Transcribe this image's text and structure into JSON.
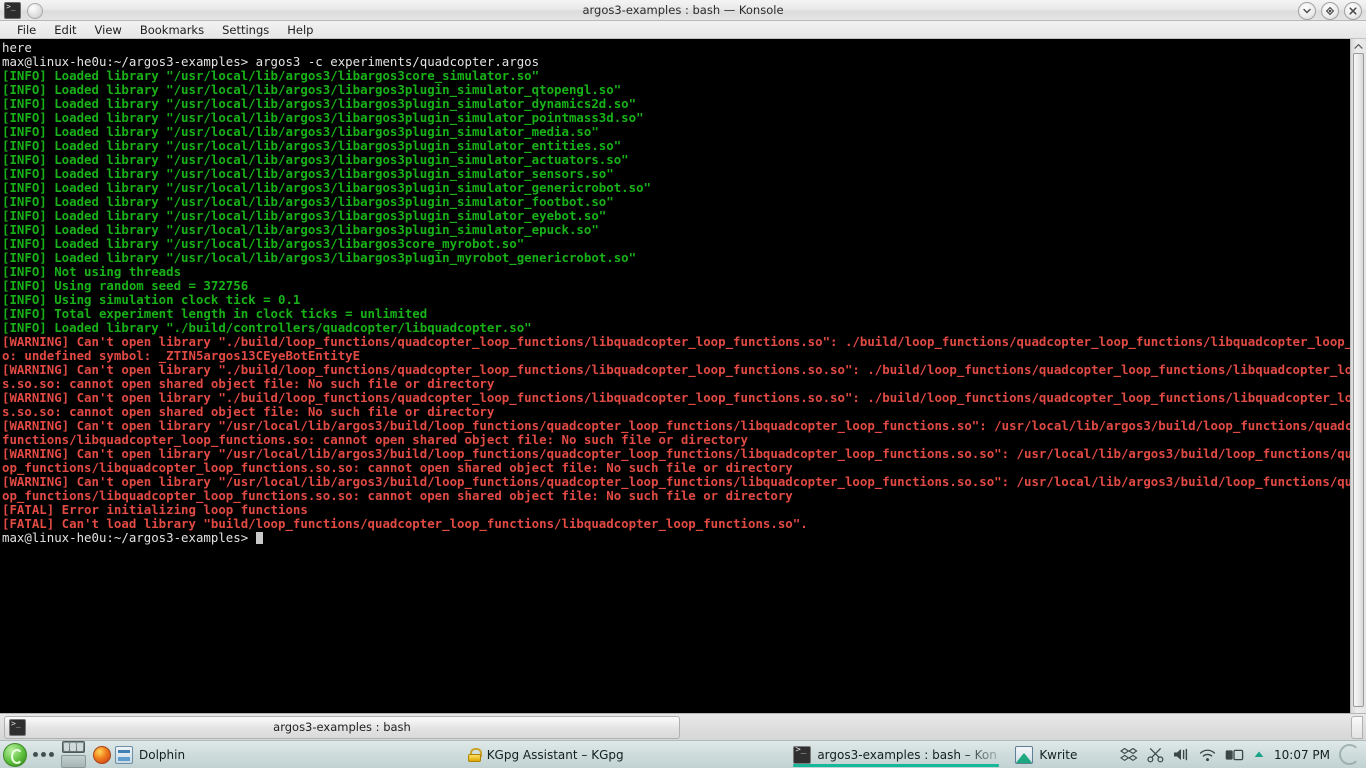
{
  "window": {
    "title": "argos3-examples : bash — Konsole",
    "app_icon": "konsole-icon",
    "controls": [
      {
        "name": "shade-button",
        "icon": "chevron-down-icon"
      },
      {
        "name": "maximize-button",
        "icon": "diamond-icon"
      },
      {
        "name": "close-button",
        "icon": "close-icon"
      }
    ]
  },
  "menubar": {
    "items": [
      {
        "label": "File"
      },
      {
        "label": "Edit"
      },
      {
        "label": "View"
      },
      {
        "label": "Bookmarks"
      },
      {
        "label": "Settings"
      },
      {
        "label": "Help"
      }
    ]
  },
  "colors": {
    "terminal_bg": "#000000",
    "text_white": "#e3e3e3",
    "text_green": "#18b218",
    "text_red": "#e24a44",
    "taskbar_accent": "#17b79a"
  },
  "terminal": {
    "prompt": "max@linux-he0u:~/argos3-examples>",
    "command": "argos3 -c experiments/quadcopter.argos",
    "lines": [
      {
        "color": "white",
        "text": "here"
      },
      {
        "color": "white",
        "text": "max@linux-he0u:~/argos3-examples> argos3 -c experiments/quadcopter.argos"
      },
      {
        "color": "green",
        "text": "[INFO] Loaded library \"/usr/local/lib/argos3/libargos3core_simulator.so\""
      },
      {
        "color": "green",
        "text": "[INFO] Loaded library \"/usr/local/lib/argos3/libargos3plugin_simulator_qtopengl.so\""
      },
      {
        "color": "green",
        "text": "[INFO] Loaded library \"/usr/local/lib/argos3/libargos3plugin_simulator_dynamics2d.so\""
      },
      {
        "color": "green",
        "text": "[INFO] Loaded library \"/usr/local/lib/argos3/libargos3plugin_simulator_pointmass3d.so\""
      },
      {
        "color": "green",
        "text": "[INFO] Loaded library \"/usr/local/lib/argos3/libargos3plugin_simulator_media.so\""
      },
      {
        "color": "green",
        "text": "[INFO] Loaded library \"/usr/local/lib/argos3/libargos3plugin_simulator_entities.so\""
      },
      {
        "color": "green",
        "text": "[INFO] Loaded library \"/usr/local/lib/argos3/libargos3plugin_simulator_actuators.so\""
      },
      {
        "color": "green",
        "text": "[INFO] Loaded library \"/usr/local/lib/argos3/libargos3plugin_simulator_sensors.so\""
      },
      {
        "color": "green",
        "text": "[INFO] Loaded library \"/usr/local/lib/argos3/libargos3plugin_simulator_genericrobot.so\""
      },
      {
        "color": "green",
        "text": "[INFO] Loaded library \"/usr/local/lib/argos3/libargos3plugin_simulator_footbot.so\""
      },
      {
        "color": "green",
        "text": "[INFO] Loaded library \"/usr/local/lib/argos3/libargos3plugin_simulator_eyebot.so\""
      },
      {
        "color": "green",
        "text": "[INFO] Loaded library \"/usr/local/lib/argos3/libargos3plugin_simulator_epuck.so\""
      },
      {
        "color": "green",
        "text": "[INFO] Loaded library \"/usr/local/lib/argos3/libargos3core_myrobot.so\""
      },
      {
        "color": "green",
        "text": "[INFO] Loaded library \"/usr/local/lib/argos3/libargos3plugin_myrobot_genericrobot.so\""
      },
      {
        "color": "green",
        "text": "[INFO] Not using threads"
      },
      {
        "color": "green",
        "text": "[INFO] Using random seed = 372756"
      },
      {
        "color": "green",
        "text": "[INFO] Using simulation clock tick = 0.1"
      },
      {
        "color": "green",
        "text": "[INFO] Total experiment length in clock ticks = unlimited"
      },
      {
        "color": "green",
        "text": "[INFO] Loaded library \"./build/controllers/quadcopter/libquadcopter.so\""
      },
      {
        "color": "red",
        "text": "[WARNING] Can't open library \"./build/loop_functions/quadcopter_loop_functions/libquadcopter_loop_functions.so\": ./build/loop_functions/quadcopter_loop_functions/libquadcopter_loop_functions.s"
      },
      {
        "color": "red",
        "text": "o: undefined symbol: _ZTIN5argos13CEyeBotEntityE"
      },
      {
        "color": "red",
        "text": "[WARNING] Can't open library \"./build/loop_functions/quadcopter_loop_functions/libquadcopter_loop_functions.so.so\": ./build/loop_functions/quadcopter_loop_functions/libquadcopter_loop_function"
      },
      {
        "color": "red",
        "text": "s.so.so: cannot open shared object file: No such file or directory"
      },
      {
        "color": "red",
        "text": "[WARNING] Can't open library \"./build/loop_functions/quadcopter_loop_functions/libquadcopter_loop_functions.so.so\": ./build/loop_functions/quadcopter_loop_functions/libquadcopter_loop_function"
      },
      {
        "color": "red",
        "text": "s.so.so: cannot open shared object file: No such file or directory"
      },
      {
        "color": "red",
        "text": "[WARNING] Can't open library \"/usr/local/lib/argos3/build/loop_functions/quadcopter_loop_functions/libquadcopter_loop_functions.so\": /usr/local/lib/argos3/build/loop_functions/quadcopter_loop_"
      },
      {
        "color": "red",
        "text": "functions/libquadcopter_loop_functions.so: cannot open shared object file: No such file or directory"
      },
      {
        "color": "red",
        "text": "[WARNING] Can't open library \"/usr/local/lib/argos3/build/loop_functions/quadcopter_loop_functions/libquadcopter_loop_functions.so.so\": /usr/local/lib/argos3/build/loop_functions/quadcopter_lo"
      },
      {
        "color": "red",
        "text": "op_functions/libquadcopter_loop_functions.so.so: cannot open shared object file: No such file or directory"
      },
      {
        "color": "red",
        "text": "[WARNING] Can't open library \"/usr/local/lib/argos3/build/loop_functions/quadcopter_loop_functions/libquadcopter_loop_functions.so.so\": /usr/local/lib/argos3/build/loop_functions/quadcopter_lo"
      },
      {
        "color": "red",
        "text": "op_functions/libquadcopter_loop_functions.so.so: cannot open shared object file: No such file or directory"
      },
      {
        "color": "red",
        "text": "[FATAL] Error initializing loop functions"
      },
      {
        "color": "red",
        "text": "[FATAL] Can't load library \"build/loop_functions/quadcopter_loop_functions/libquadcopter_loop_functions.so\"."
      }
    ],
    "final_prompt": "max@linux-he0u:~/argos3-examples> "
  },
  "tabbar": {
    "tab_label": "argos3-examples : bash"
  },
  "taskbar": {
    "tasks": [
      {
        "label": "Dolphin",
        "icon": "dolphin-icon",
        "active": false
      },
      {
        "label": "KGpg Assistant – KGpg",
        "icon": "lock-icon",
        "active": false
      },
      {
        "label": "argos3-examples : bash – Kon",
        "icon": "konsole-icon",
        "active": true
      },
      {
        "label": "Kwrite",
        "icon": "kwrite-icon",
        "active": false
      }
    ],
    "launcher_label": "application-launcher",
    "tray": {
      "icons": [
        "dropbox-icon",
        "klipper-scissors-icon",
        "volume-icon",
        "wifi-icon",
        "battery-icon",
        "show-hidden-arrow-icon"
      ],
      "clock": "10:07 PM"
    }
  }
}
